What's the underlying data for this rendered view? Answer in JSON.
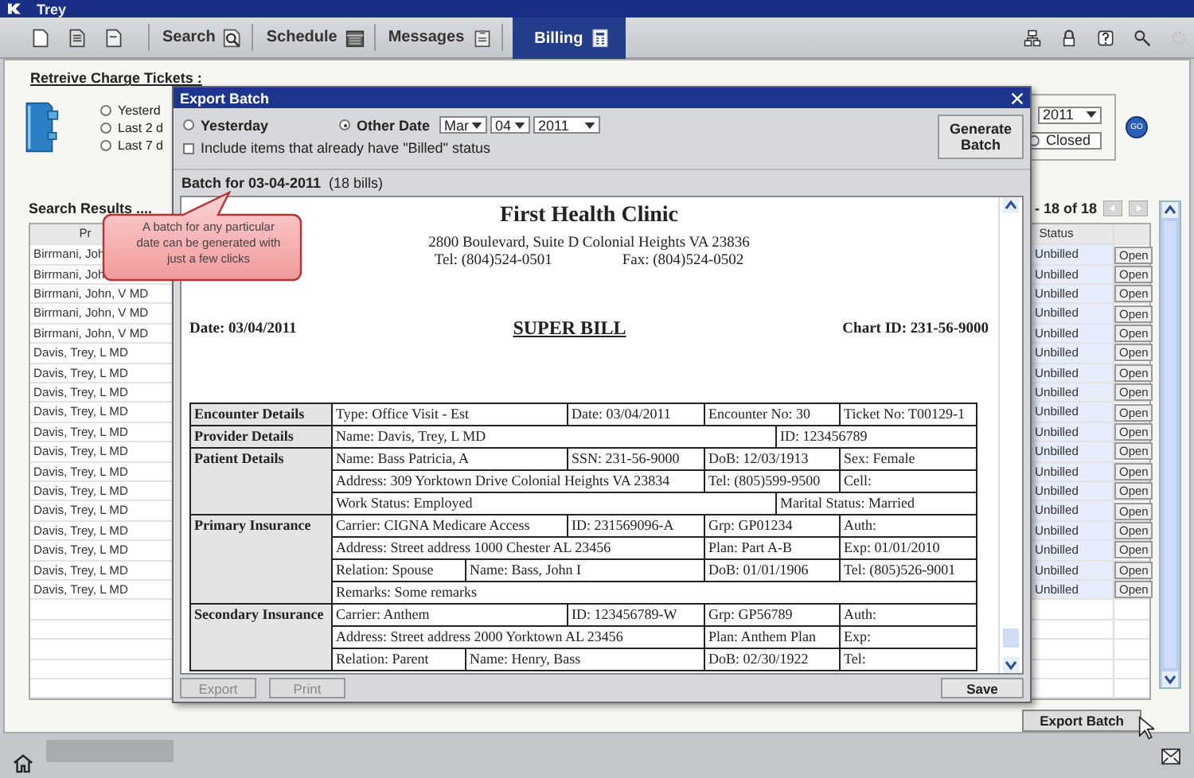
{
  "window": {
    "title": "Trey"
  },
  "toolbar": {
    "tabs": [
      {
        "label": "Search",
        "selected": false
      },
      {
        "label": "Schedule",
        "selected": false
      },
      {
        "label": "Messages",
        "selected": false
      },
      {
        "label": "Billing",
        "selected": true
      }
    ]
  },
  "retrieve": {
    "title": "Retreive Charge Tickets :",
    "ranges": [
      {
        "label": "Yesterd",
        "selected": false
      },
      {
        "label": "Last 2 d",
        "selected": false
      },
      {
        "label": "Last 7 d",
        "selected": false
      }
    ],
    "year": "2011",
    "closed": {
      "label": "Closed",
      "selected": false
    },
    "go": "GO"
  },
  "results": {
    "title": "Search Results ....",
    "pager": "- 18 of 18",
    "columns": [
      "Pr",
      "Status"
    ],
    "rows": [
      {
        "provider": "Birrmani, Joh",
        "status": "Unbilled",
        "action": "Open"
      },
      {
        "provider": "Birrmani, Joh",
        "status": "Unbilled",
        "action": "Open"
      },
      {
        "provider": "Birrmani, John, V MD",
        "status": "Unbilled",
        "action": "Open"
      },
      {
        "provider": "Birrmani, John, V MD",
        "status": "Unbilled",
        "action": "Open"
      },
      {
        "provider": "Birrmani, John, V MD",
        "status": "Unbilled",
        "action": "Open"
      },
      {
        "provider": "Davis, Trey, L MD",
        "status": "Unbilled",
        "action": "Open"
      },
      {
        "provider": "Davis, Trey, L MD",
        "status": "Unbilled",
        "action": "Open"
      },
      {
        "provider": "Davis, Trey, L MD",
        "status": "Unbilled",
        "action": "Open"
      },
      {
        "provider": "Davis, Trey, L MD",
        "status": "Unbilled",
        "action": "Open"
      },
      {
        "provider": "Davis, Trey, L MD",
        "status": "Unbilled",
        "action": "Open"
      },
      {
        "provider": "Davis, Trey, L MD",
        "status": "Unbilled",
        "action": "Open"
      },
      {
        "provider": "Davis, Trey, L MD",
        "status": "Unbilled",
        "action": "Open"
      },
      {
        "provider": "Davis, Trey, L MD",
        "status": "Unbilled",
        "action": "Open"
      },
      {
        "provider": "Davis, Trey, L MD",
        "status": "Unbilled",
        "action": "Open"
      },
      {
        "provider": "Davis, Trey, L MD",
        "status": "Unbilled",
        "action": "Open"
      },
      {
        "provider": "Davis, Trey, L MD",
        "status": "Unbilled",
        "action": "Open"
      },
      {
        "provider": "Davis, Trey, L MD",
        "status": "Unbilled",
        "action": "Open"
      },
      {
        "provider": "Davis, Trey, L MD",
        "status": "Unbilled",
        "action": "Open"
      }
    ]
  },
  "export_batch_button": "Export Batch",
  "dialog": {
    "title": "Export Batch",
    "modes": [
      {
        "label": "Yesterday",
        "selected": false
      },
      {
        "label": "Other Date",
        "selected": true
      }
    ],
    "month": "Mar",
    "day": "04",
    "year": "2011",
    "include_billed": {
      "label": "Include items that already have \"Billed\" status",
      "checked": false
    },
    "generate_button": "Generate Batch",
    "batch_title": "Batch for 03-04-2011",
    "batch_count": "(18 bills)",
    "bill": {
      "clinic": "First Health Clinic",
      "address": "2800 Boulevard, Suite D Colonial Heights VA 23836",
      "tel": "Tel: (804)524-0501",
      "fax": "Fax: (804)524-0502",
      "date": "Date: 03/04/2011",
      "title": "SUPER BILL",
      "chart_id": "Chart ID: 231-56-9000",
      "sections": [
        {
          "heading": "Encounter Details",
          "rows": [
            [
              {
                "text": "Type: Office Visit - Est",
                "colspan": 2
              },
              {
                "text": "Date: 03/04/2011"
              },
              {
                "text": "Encounter No: 30",
                "colspan": 2
              },
              {
                "text": "Ticket No: T00129-1"
              }
            ]
          ]
        },
        {
          "heading": "Provider Details",
          "rows": [
            [
              {
                "text": "Name: Davis, Trey, L MD",
                "colspan": 4
              },
              {
                "text": "ID: 123456789",
                "colspan": 2
              }
            ]
          ]
        },
        {
          "heading": "Patient Details",
          "rows": [
            [
              {
                "text": "Name: Bass Patricia, A",
                "colspan": 2
              },
              {
                "text": "SSN: 231-56-9000"
              },
              {
                "text": "DoB: 12/03/1913",
                "colspan": 2
              },
              {
                "text": "Sex: Female"
              }
            ],
            [
              {
                "text": "Address: 309 Yorktown Drive Colonial Heights VA 23834",
                "colspan": 3
              },
              {
                "text": "Tel: (805)599-9500",
                "colspan": 2
              },
              {
                "text": "Cell:"
              }
            ],
            [
              {
                "text": "Work Status: Employed",
                "colspan": 4
              },
              {
                "text": "Marital Status: Married",
                "colspan": 2
              }
            ]
          ]
        },
        {
          "heading": "Primary Insurance",
          "rows": [
            [
              {
                "text": "Carrier: CIGNA Medicare Access",
                "colspan": 2
              },
              {
                "text": "ID: 231569096-A"
              },
              {
                "text": "Grp: GP01234",
                "colspan": 2
              },
              {
                "text": "Auth:"
              }
            ],
            [
              {
                "text": "Address: Street address 1000 Chester AL 23456",
                "colspan": 3
              },
              {
                "text": "Plan: Part A-B",
                "colspan": 2
              },
              {
                "text": "Exp: 01/01/2010"
              }
            ],
            [
              {
                "text": "Relation: Spouse"
              },
              {
                "text": "Name: Bass, John I",
                "colspan": 2
              },
              {
                "text": "DoB: 01/01/1906",
                "colspan": 2
              },
              {
                "text": "Tel: (805)526-9001"
              }
            ],
            [
              {
                "text": "Remarks: Some remarks",
                "colspan": 6
              }
            ]
          ]
        },
        {
          "heading": "Secondary Insurance",
          "rows": [
            [
              {
                "text": "Carrier: Anthem",
                "colspan": 2
              },
              {
                "text": "ID: 123456789-W"
              },
              {
                "text": "Grp: GP56789",
                "colspan": 2
              },
              {
                "text": "Auth:"
              }
            ],
            [
              {
                "text": "Address: Street address 2000 Yorktown AL 23456",
                "colspan": 3
              },
              {
                "text": "Plan: Anthem Plan",
                "colspan": 2
              },
              {
                "text": "Exp:"
              }
            ],
            [
              {
                "text": "Relation: Parent"
              },
              {
                "text": "Name: Henry, Bass",
                "colspan": 2
              },
              {
                "text": "DoB: 02/30/1922",
                "colspan": 2
              },
              {
                "text": "Tel:"
              }
            ]
          ]
        }
      ]
    },
    "buttons": [
      {
        "label": "Export",
        "disabled": true
      },
      {
        "label": "Print",
        "disabled": true
      },
      {
        "label": "Save",
        "disabled": false
      }
    ]
  },
  "callout": {
    "text": "A batch for any particular date can be generated with just a few clicks"
  }
}
